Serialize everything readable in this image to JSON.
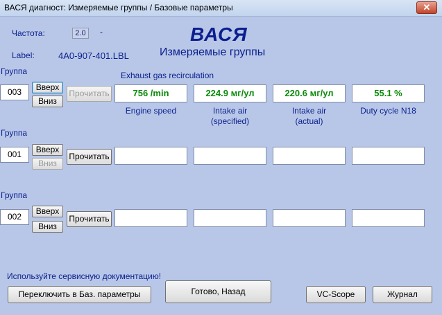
{
  "window": {
    "title": "ВАСЯ диагност: Измеряемые группы / Базовые параметры",
    "close_label": "✕"
  },
  "header": {
    "freq_label": "Частота:",
    "freq_value": "2.0",
    "freq_dash": "-",
    "label_label": "Label:",
    "label_value": "4A0-907-401.LBL",
    "app_title": "ВАСЯ",
    "app_subtitle": "Измеряемые группы"
  },
  "groups": [
    {
      "group_label": "Группа",
      "number": "003",
      "up_label": "Вверх",
      "down_label": "Вниз",
      "read_label": "Прочитать",
      "section_title": "Exhaust gas recirculation",
      "fields": [
        {
          "value": "756 /min",
          "caption_1": "Engine speed",
          "caption_2": ""
        },
        {
          "value": "224.9 мг/ул",
          "caption_1": "Intake air",
          "caption_2": "(specified)"
        },
        {
          "value": "220.6 мг/ул",
          "caption_1": "Intake air",
          "caption_2": "(actual)"
        },
        {
          "value": "55.1 %",
          "caption_1": "Duty cycle N18",
          "caption_2": ""
        }
      ]
    },
    {
      "group_label": "Группа",
      "number": "001",
      "up_label": "Вверх",
      "down_label": "Вниз",
      "read_label": "Прочитать"
    },
    {
      "group_label": "Группа",
      "number": "002",
      "up_label": "Вверх",
      "down_label": "Вниз",
      "read_label": "Прочитать"
    }
  ],
  "footer": {
    "service_note": "Используйте сервисную документацию!",
    "switch_label": "Переключить в Баз. параметры",
    "done_label": "Готово, Назад",
    "vcscope_label": "VC-Scope",
    "journal_label": "Журнал"
  },
  "colors": {
    "background": "#b8c7e7",
    "value_text": "#0a8a0a",
    "label_text": "#0b1f8f"
  }
}
